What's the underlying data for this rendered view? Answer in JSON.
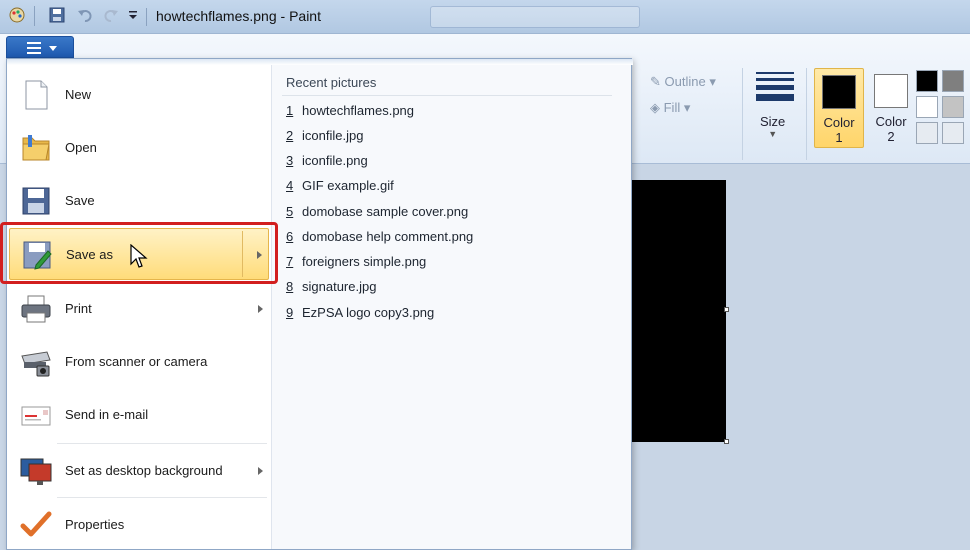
{
  "window": {
    "title": "howtechflames.png - Paint"
  },
  "ribbon": {
    "outline_label": "Outline",
    "fill_label": "Fill",
    "size_label": "Size",
    "color1_label_line1": "Color",
    "color1_label_line2": "1",
    "color2_label_line1": "Color",
    "color2_label_line2": "2",
    "color1_value": "#000000",
    "color2_value": "#ffffff",
    "palette": [
      "#000000",
      "#7f7f7f",
      "#ffffff",
      "#c3c3c3",
      "#e6ebf1",
      "#e6ebf1"
    ]
  },
  "file_menu": {
    "items": [
      {
        "label": "New",
        "icon": "new-document-icon",
        "submenu": false
      },
      {
        "label": "Open",
        "icon": "open-folder-icon",
        "submenu": false
      },
      {
        "label": "Save",
        "icon": "save-disk-icon",
        "submenu": false
      },
      {
        "label": "Save as",
        "icon": "save-as-icon",
        "submenu": true,
        "highlighted": true
      },
      {
        "label": "Print",
        "icon": "printer-icon",
        "submenu": true
      },
      {
        "label": "From scanner or camera",
        "icon": "scanner-icon",
        "submenu": false
      },
      {
        "label": "Send in e-mail",
        "icon": "email-icon",
        "submenu": false
      },
      {
        "label": "Set as desktop background",
        "icon": "desktop-background-icon",
        "submenu": true
      },
      {
        "label": "Properties",
        "icon": "properties-check-icon",
        "submenu": false
      }
    ]
  },
  "recent": {
    "title": "Recent pictures",
    "items": [
      {
        "num": "1",
        "name": "howtechflames.png"
      },
      {
        "num": "2",
        "name": "iconfile.jpg"
      },
      {
        "num": "3",
        "name": "iconfile.png"
      },
      {
        "num": "4",
        "name": "GIF example.gif"
      },
      {
        "num": "5",
        "name": "domobase sample cover.png"
      },
      {
        "num": "6",
        "name": "domobase help comment.png"
      },
      {
        "num": "7",
        "name": "foreigners simple.png"
      },
      {
        "num": "8",
        "name": "signature.jpg"
      },
      {
        "num": "9",
        "name": "EzPSA logo copy3.png"
      }
    ]
  }
}
